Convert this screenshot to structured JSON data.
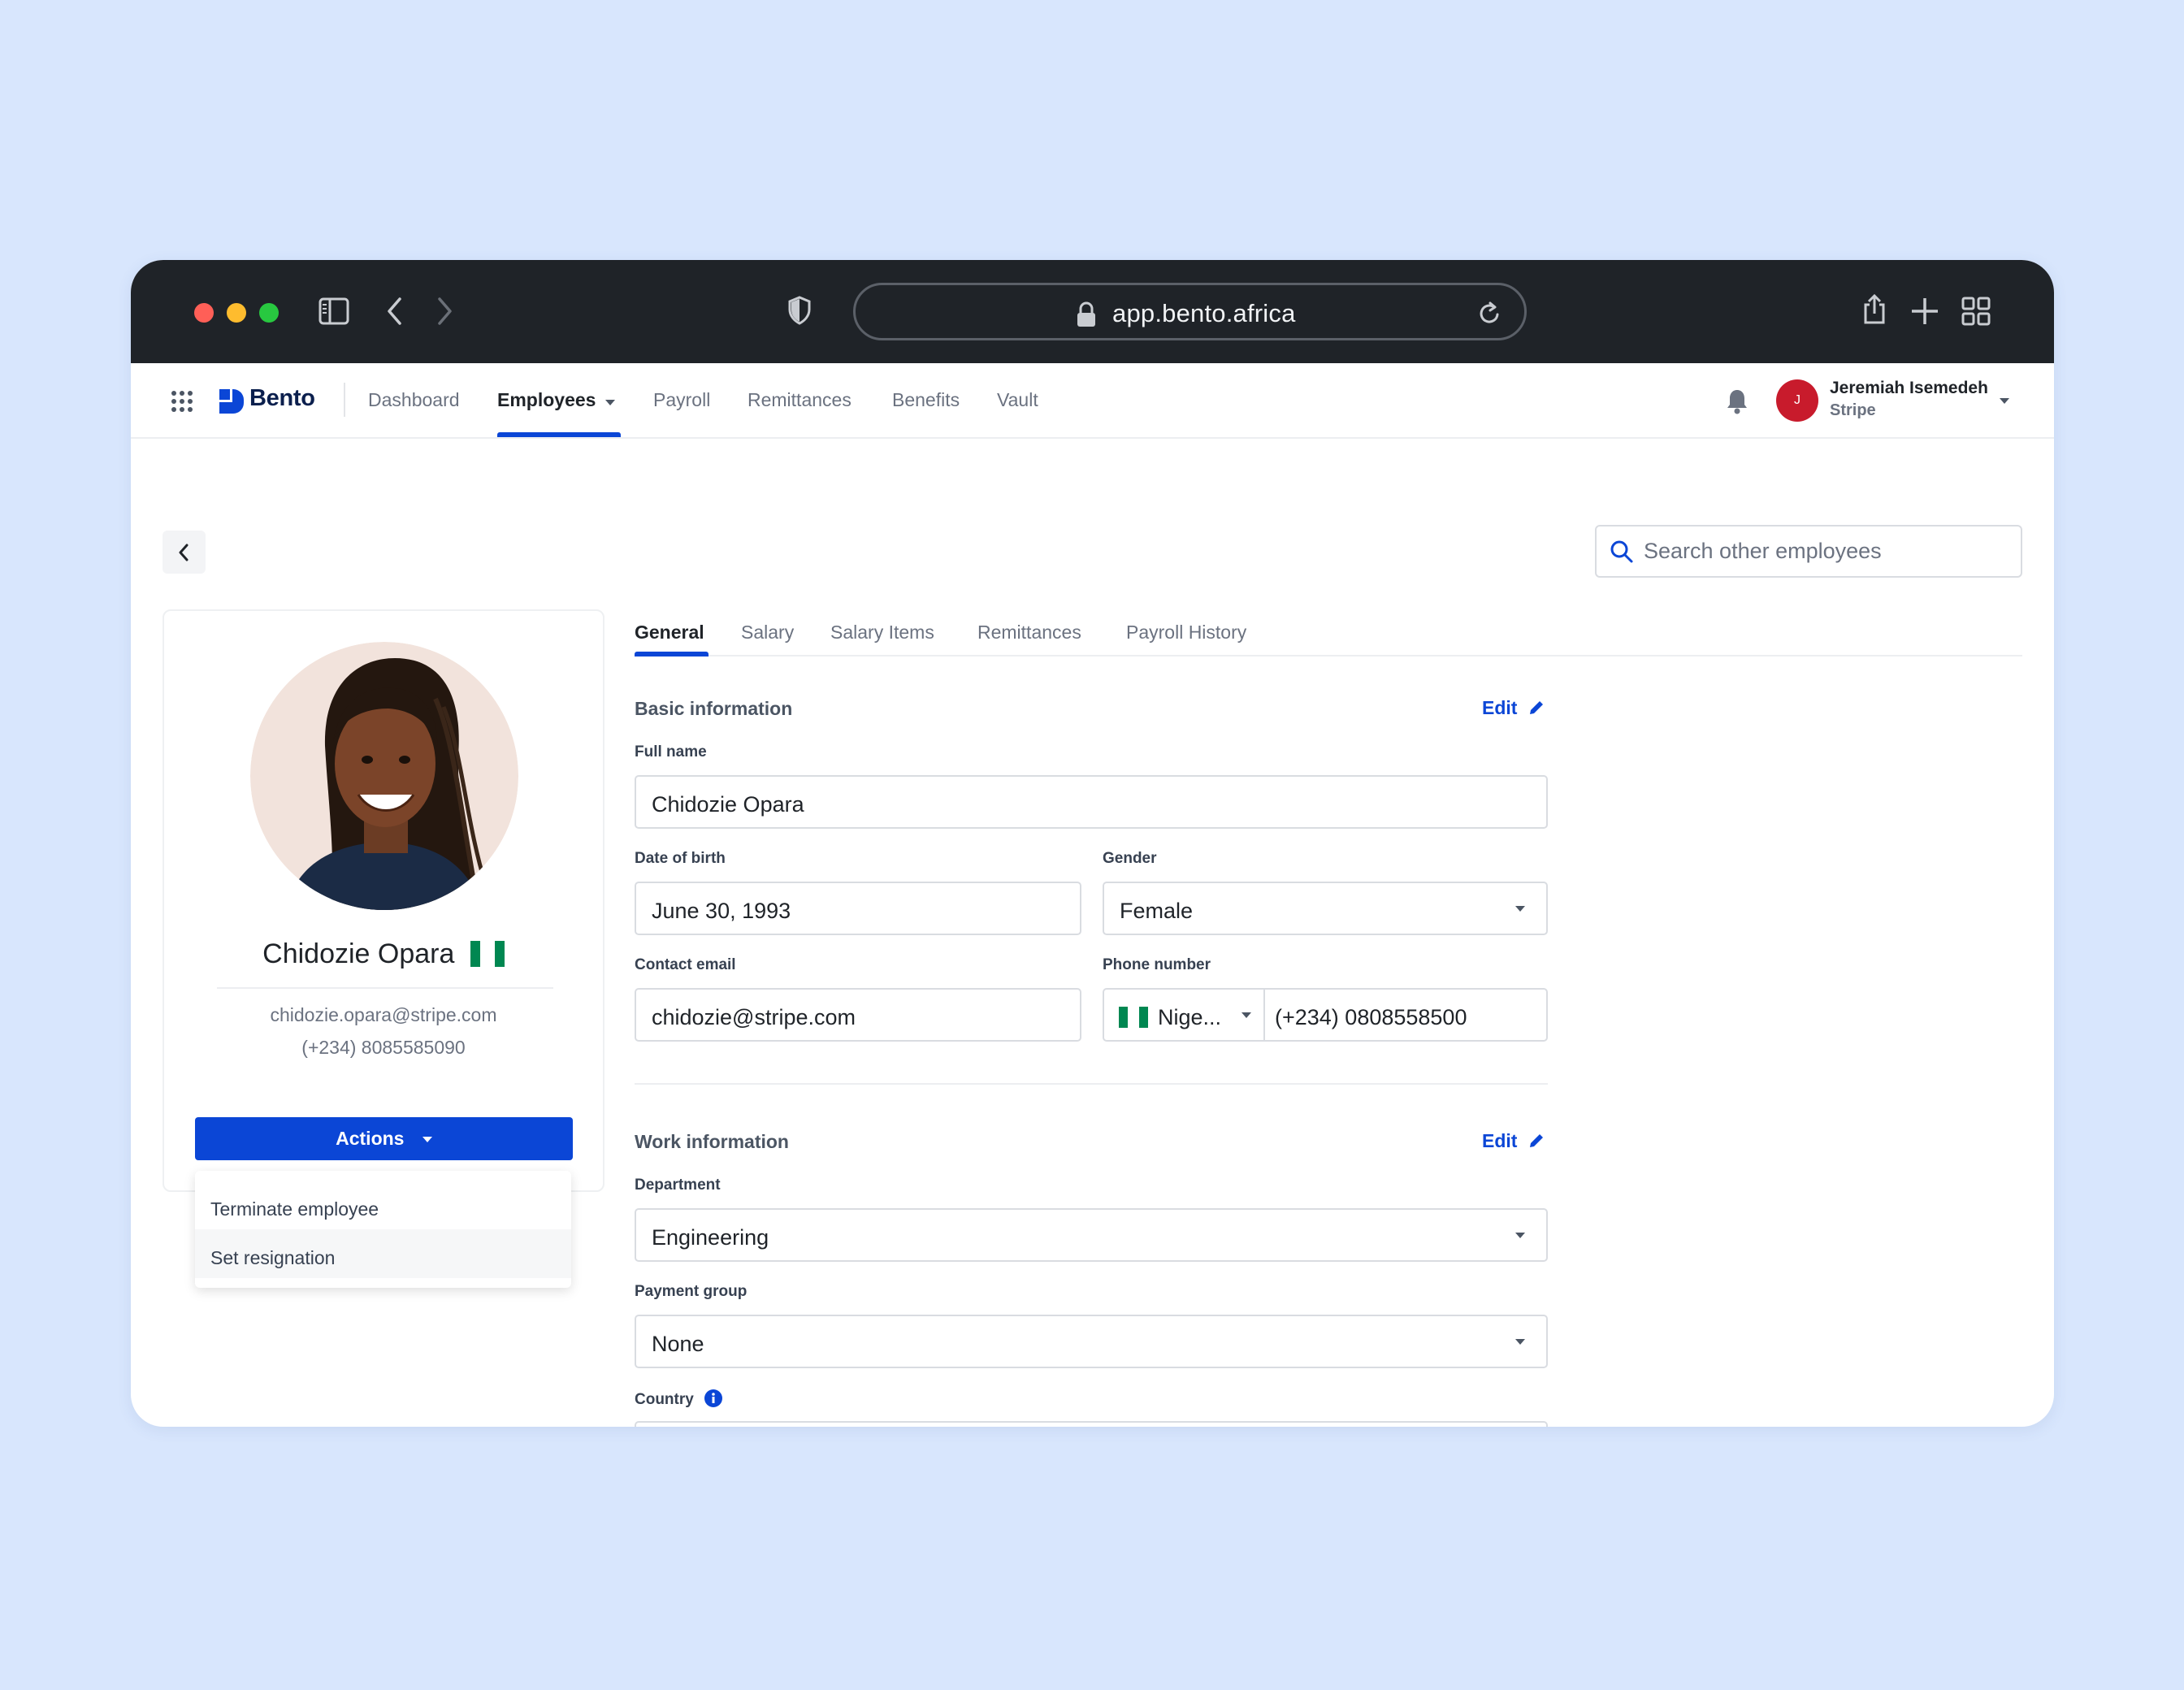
{
  "browser": {
    "url": "app.bento.africa",
    "colors": {
      "close": "#ff5f57",
      "minimize": "#febc2e",
      "maximize": "#28c840"
    }
  },
  "nav": {
    "brand": "Bento",
    "links": [
      {
        "label": "Dashboard"
      },
      {
        "label": "Employees"
      },
      {
        "label": "Payroll"
      },
      {
        "label": "Remittances"
      },
      {
        "label": "Benefits"
      },
      {
        "label": "Vault"
      }
    ],
    "active": "Employees",
    "user": {
      "initial": "J",
      "name": "Jeremiah Isemedeh",
      "org": "Stripe"
    }
  },
  "search": {
    "placeholder": "Search other employees"
  },
  "profile": {
    "name": "Chidozie Opara",
    "email": "chidozie.opara@stripe.com",
    "phone": "(+234) 8085585090",
    "flag_colors": [
      "#008751",
      "#ffffff",
      "#008751"
    ]
  },
  "actions": {
    "label": "Actions",
    "menu": [
      {
        "label": "Terminate employee"
      },
      {
        "label": "Set resignation"
      }
    ]
  },
  "tabs": [
    {
      "label": "General"
    },
    {
      "label": "Salary"
    },
    {
      "label": "Salary Items"
    },
    {
      "label": "Remittances"
    },
    {
      "label": "Payroll History"
    }
  ],
  "basic": {
    "title": "Basic information",
    "edit": "Edit",
    "full_name_label": "Full name",
    "full_name": "Chidozie Opara",
    "dob_label": "Date of birth",
    "dob": "June 30, 1993",
    "gender_label": "Gender",
    "gender": "Female",
    "email_label": "Contact email",
    "email": "chidozie@stripe.com",
    "phone_label": "Phone number",
    "phone_country": "Nige...",
    "phone": "(+234) 0808558500"
  },
  "work": {
    "title": "Work information",
    "edit": "Edit",
    "department_label": "Department",
    "department": "Engineering",
    "payment_group_label": "Payment group",
    "payment_group": "None",
    "country_label": "Country"
  },
  "colors": {
    "accent": "#0b46d6",
    "avatar": "#c81b2c"
  }
}
